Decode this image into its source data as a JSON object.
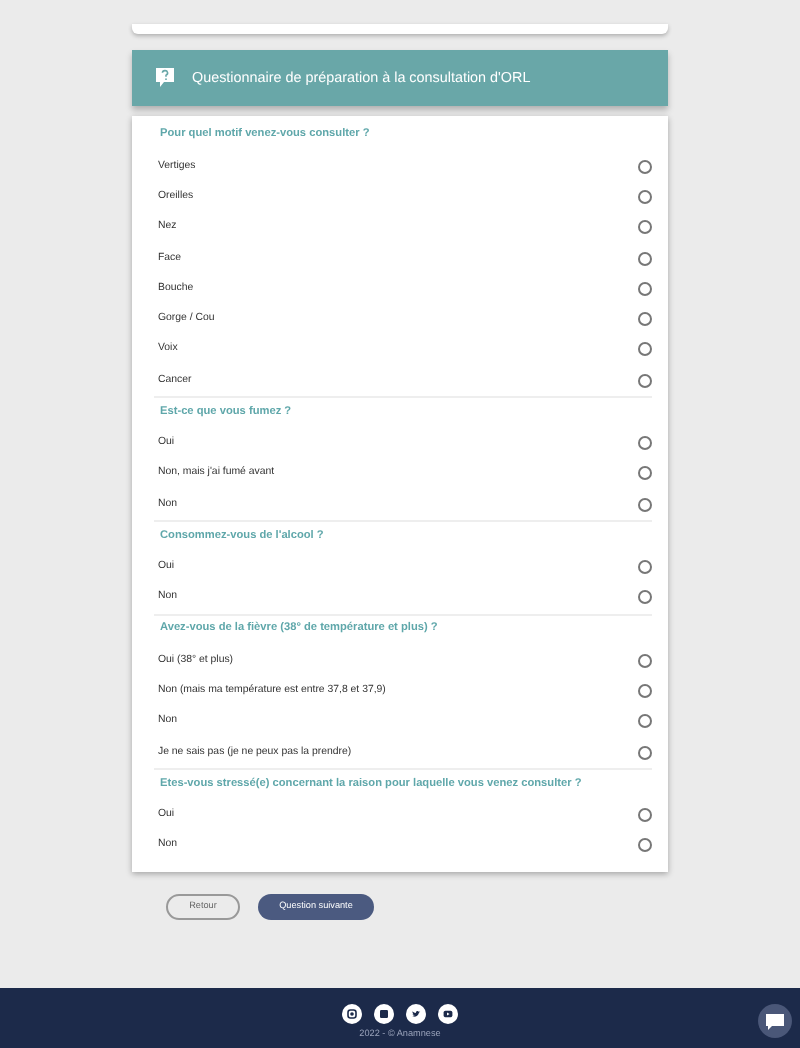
{
  "header": {
    "title": "Questionnaire de préparation à la consultation d'ORL"
  },
  "questions": [
    {
      "title": "Pour quel motif venez-vous consulter ?",
      "options": [
        {
          "label": "Vertiges",
          "selected": false
        },
        {
          "label": "Oreilles",
          "selected": false
        },
        {
          "label": "Nez",
          "selected": false
        },
        {
          "label": "Face",
          "selected": false
        },
        {
          "label": "Bouche",
          "selected": false
        },
        {
          "label": "Gorge / Cou",
          "selected": false
        },
        {
          "label": "Voix",
          "selected": false
        },
        {
          "label": "Cancer",
          "selected": false
        }
      ]
    },
    {
      "title": "Est-ce que vous fumez ?",
      "options": [
        {
          "label": "Oui",
          "selected": false
        },
        {
          "label": "Non, mais j'ai fumé avant",
          "selected": false
        },
        {
          "label": "Non",
          "selected": false
        }
      ]
    },
    {
      "title": "Consommez-vous de l'alcool ?",
      "options": [
        {
          "label": "Oui",
          "selected": false
        },
        {
          "label": "Non",
          "selected": false
        }
      ]
    },
    {
      "title": "Avez-vous de la fièvre (38° de température et plus) ?",
      "options": [
        {
          "label": "Oui (38° et plus)",
          "selected": false
        },
        {
          "label": "Non (mais ma température est entre 37,8 et 37,9)",
          "selected": false
        },
        {
          "label": "Non",
          "selected": false
        },
        {
          "label": "Je ne sais pas (je ne peux pas la prendre)",
          "selected": false
        }
      ]
    },
    {
      "title": "Etes-vous stressé(e) concernant la raison pour laquelle vous venez consulter ?",
      "options": [
        {
          "label": "Oui",
          "selected": false
        },
        {
          "label": "Non",
          "selected": false
        }
      ]
    }
  ],
  "buttons": {
    "back": "Retour",
    "next": "Question suivante"
  },
  "footer": {
    "social": [
      {
        "kind": "camera"
      },
      {
        "kind": "square"
      },
      {
        "kind": "bird"
      },
      {
        "kind": "play"
      }
    ],
    "copyright": "2022 - © Anamnese"
  }
}
